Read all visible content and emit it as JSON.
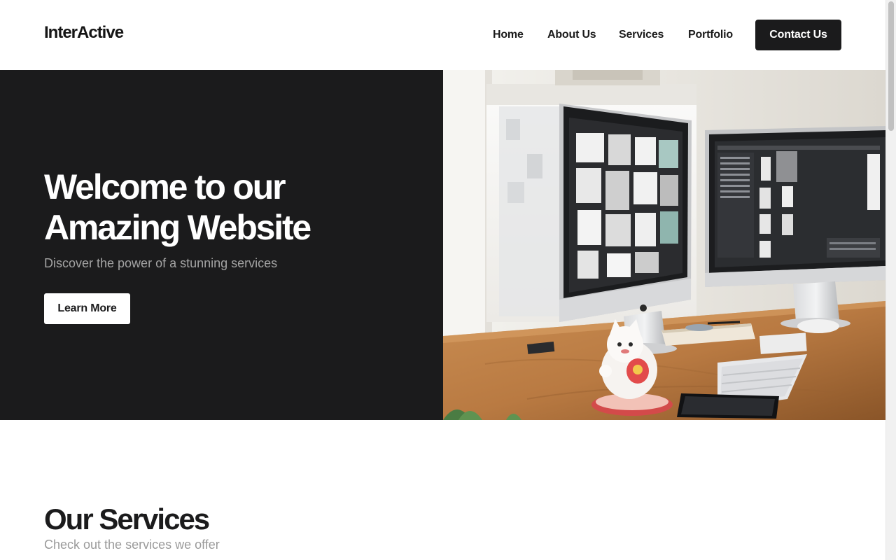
{
  "header": {
    "logo": "InterActive",
    "nav": [
      {
        "label": "Home"
      },
      {
        "label": "About Us"
      },
      {
        "label": "Services"
      },
      {
        "label": "Portfolio"
      }
    ],
    "contact_label": "Contact Us"
  },
  "hero": {
    "title": "Welcome to our Amazing Website",
    "subtitle": "Discover the power of a stunning services",
    "button_label": "Learn More",
    "image": "workspace-photo"
  },
  "services": {
    "title": "Our Services",
    "subtitle": "Check out the services we offer"
  },
  "colors": {
    "dark": "#1b1b1c",
    "white": "#ffffff",
    "muted": "#a3a3a3"
  }
}
